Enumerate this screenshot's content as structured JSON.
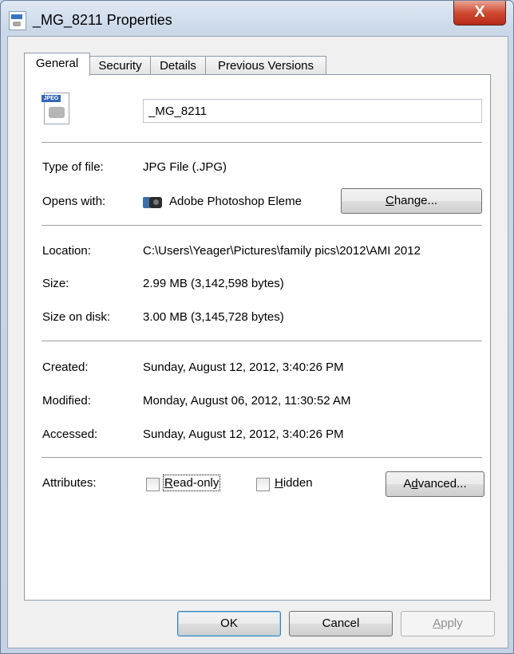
{
  "window": {
    "title": "_MG_8211 Properties",
    "close_label": "X"
  },
  "tabs": [
    {
      "label": "General",
      "active": true
    },
    {
      "label": "Security",
      "active": false
    },
    {
      "label": "Details",
      "active": false
    },
    {
      "label": "Previous Versions",
      "active": false
    }
  ],
  "general": {
    "file_icon_badge": "JPEG",
    "file_name": "_MG_8211",
    "type_label": "Type of file:",
    "type_value": "JPG File (.JPG)",
    "opens_label": "Opens with:",
    "opens_value": "Adobe Photoshop Eleme",
    "change_button": {
      "pre": "",
      "mnemonic": "C",
      "post": "hange..."
    },
    "location_label": "Location:",
    "location_value": "C:\\Users\\Yeager\\Pictures\\family pics\\2012\\AMI 2012",
    "size_label": "Size:",
    "size_value": "2.99 MB (3,142,598 bytes)",
    "size_disk_label": "Size on disk:",
    "size_disk_value": "3.00 MB (3,145,728 bytes)",
    "created_label": "Created:",
    "created_value": "Sunday, August 12, 2012, 3:40:26 PM",
    "modified_label": "Modified:",
    "modified_value": "Monday, August 06, 2012, 11:30:52 AM",
    "accessed_label": "Accessed:",
    "accessed_value": "Sunday, August 12, 2012, 3:40:26 PM",
    "attributes_label": "Attributes:",
    "readonly": {
      "mnemonic": "R",
      "rest": "ead-only",
      "checked": false
    },
    "hidden": {
      "mnemonic": "H",
      "rest": "idden",
      "checked": false
    },
    "advanced_button": {
      "pre": "A",
      "mnemonic": "d",
      "post": "vanced..."
    }
  },
  "footer": {
    "ok": "OK",
    "cancel": "Cancel",
    "apply": {
      "mnemonic": "A",
      "rest": "pply"
    }
  }
}
